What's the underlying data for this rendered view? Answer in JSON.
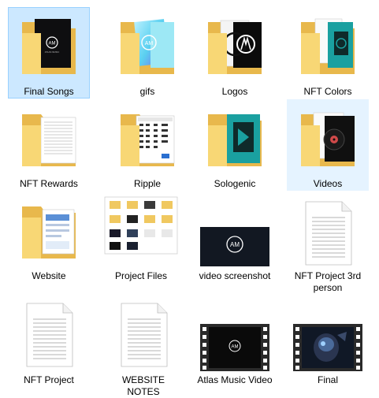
{
  "items": [
    {
      "label": "Final Songs",
      "type": "folder",
      "preview": "dark-cover"
    },
    {
      "label": "gifs",
      "type": "folder",
      "preview": "gradient-logo"
    },
    {
      "label": "Logos",
      "type": "folder",
      "preview": "white-logo-on-black"
    },
    {
      "label": "NFT Colors",
      "type": "folder",
      "preview": "teal-images"
    },
    {
      "label": "NFT Rewards",
      "type": "folder",
      "preview": "text-documents"
    },
    {
      "label": "Ripple",
      "type": "folder",
      "preview": "document-with-grid"
    },
    {
      "label": "Sologenic",
      "type": "folder",
      "preview": "teal-app-icon"
    },
    {
      "label": "Videos",
      "type": "folder",
      "preview": "vinyl-record"
    },
    {
      "label": "Website",
      "type": "folder",
      "preview": "blue-document"
    },
    {
      "label": "Project Files",
      "type": "image",
      "preview": "folder-grid-screenshot"
    },
    {
      "label": "video screenshot",
      "type": "image",
      "preview": "dark-logo-banner"
    },
    {
      "label": "NFT Project 3rd person",
      "type": "document",
      "preview": "blank-page"
    },
    {
      "label": "NFT Project",
      "type": "document",
      "preview": "blank-page"
    },
    {
      "label": "WEBSITE NOTES",
      "type": "document",
      "preview": "blank-page"
    },
    {
      "label": "Atlas Music Video",
      "type": "video",
      "preview": "dark-logo-frame"
    },
    {
      "label": "Final",
      "type": "video",
      "preview": "helmet-figure-frame"
    }
  ],
  "state": {
    "selected": "Final Songs",
    "hovered": "Videos"
  },
  "colors": {
    "selection_bg": "#cce8ff",
    "selection_border": "#99d1ff",
    "hover_bg": "#e5f3ff",
    "folder_back": "#e8b84c",
    "folder_front": "#f8d775",
    "teal": "#1aa0a0"
  },
  "logo_text": "AM",
  "logo_subtitle": "ATLAS MUSIC"
}
